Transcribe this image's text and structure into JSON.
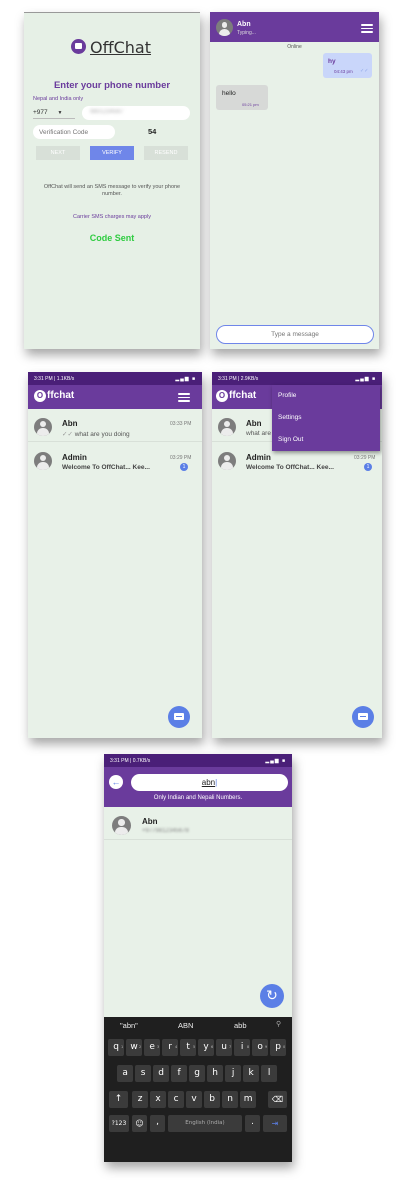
{
  "login": {
    "brand": "OffChat",
    "heading": "Enter your phone number",
    "subtext": "Nepal and India only",
    "country_code": "+977",
    "phone_value": "9801234567",
    "verification_placeholder": "Verification Code",
    "countdown": "54",
    "next_label": "NEXT",
    "verify_label": "VERIFY",
    "resend_label": "RESEND",
    "sms_note": "OffChat will send an SMS message to verify your phone number.",
    "charges_note": "Carrier SMS charges may apply",
    "code_sent": "Code Sent"
  },
  "chat": {
    "contact_name": "Abn",
    "contact_status": "Typing...",
    "online_label": "Online",
    "messages": [
      {
        "text": "hy",
        "time": "04:43 pm",
        "direction": "out"
      },
      {
        "text": "hello",
        "time": "05:21 pm",
        "direction": "in"
      }
    ],
    "input_placeholder": "Type a message"
  },
  "list": {
    "status_left": "3:31 PM | 1.1KB/s",
    "status_right": "4G",
    "title": "ffchat",
    "items": [
      {
        "name": "Abn",
        "message": "what are you doing",
        "time": "03:33 PM"
      },
      {
        "name": "Admin",
        "message": "Welcome To OffChat... Kee...",
        "time": "03:29 PM",
        "badge": "1"
      }
    ]
  },
  "menu": {
    "status_left": "3:31 PM | 2.9KB/s",
    "items": [
      "Profile",
      "Settings",
      "Sign Out"
    ]
  },
  "search": {
    "status_left": "3:31 PM | 0.7KB/s",
    "query": "abn",
    "notice": "Only Indian and Nepali Numbers.",
    "result_name": "Abn",
    "result_number": "+9779812345678"
  },
  "keyboard": {
    "suggestions": [
      "\"abn\"",
      "ABN",
      "abb"
    ],
    "row1": [
      "q",
      "w",
      "e",
      "r",
      "t",
      "y",
      "u",
      "i",
      "o",
      "p"
    ],
    "row1_nums": [
      "1",
      "2",
      "3",
      "4",
      "5",
      "6",
      "7",
      "8",
      "9",
      "0"
    ],
    "row2": [
      "a",
      "s",
      "d",
      "f",
      "g",
      "h",
      "j",
      "k",
      "l"
    ],
    "row3": [
      "z",
      "x",
      "c",
      "v",
      "b",
      "n",
      "m"
    ],
    "symbols_label": "?123",
    "comma": ",",
    "space_label": "English (India)",
    "period": "."
  },
  "colors": {
    "primary": "#6a3b9c",
    "accent": "#5b7fe6",
    "background": "#e8f1e8",
    "success": "#2ecc40"
  }
}
